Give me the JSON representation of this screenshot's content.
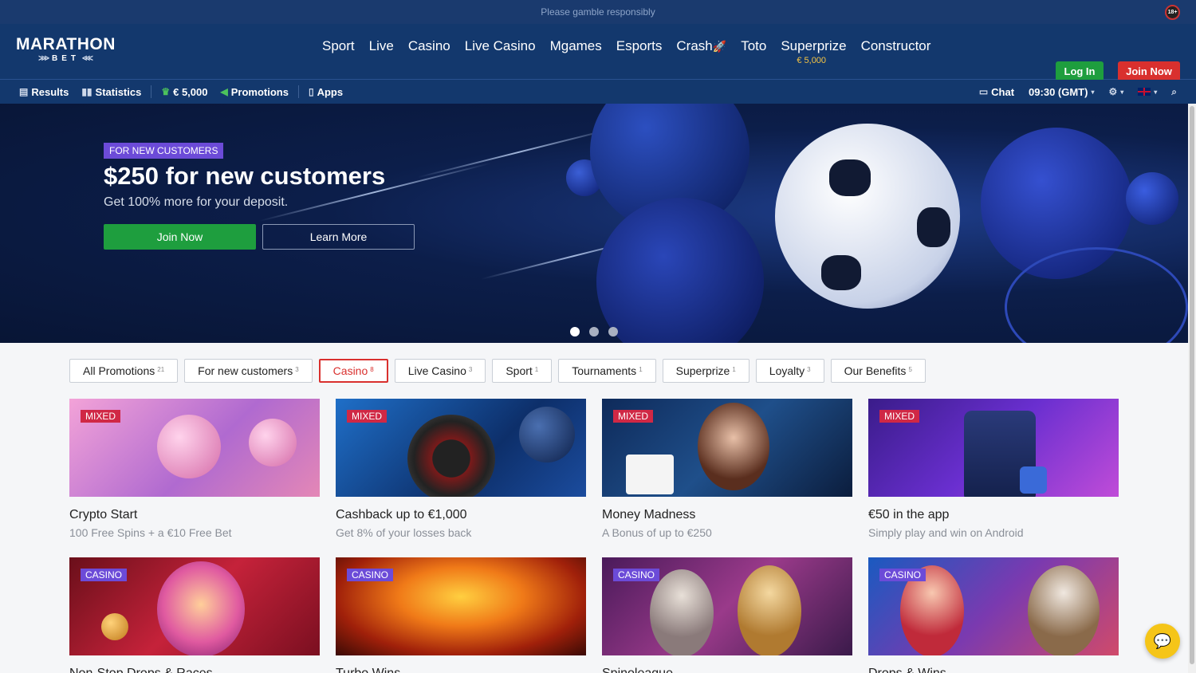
{
  "topbar": {
    "notice": "Please gamble responsibly",
    "age_badge": "18+"
  },
  "header": {
    "logo": {
      "main": "MARATHON",
      "sub": "BET"
    },
    "nav": [
      {
        "label": "Sport"
      },
      {
        "label": "Live"
      },
      {
        "label": "Casino"
      },
      {
        "label": "Live Casino"
      },
      {
        "label": "Mgames"
      },
      {
        "label": "Esports"
      },
      {
        "label": "Crash"
      },
      {
        "label": "Toto"
      },
      {
        "label": "Superprize",
        "sub": "€ 5,000"
      },
      {
        "label": "Constructor"
      }
    ],
    "login_label": "Log In",
    "join_label": "Join Now"
  },
  "subnav": {
    "results": "Results",
    "statistics": "Statistics",
    "jackpot": "€ 5,000",
    "promotions": "Promotions",
    "apps": "Apps",
    "chat": "Chat",
    "time": "09:30 (GMT)"
  },
  "hero": {
    "tag": "FOR NEW CUSTOMERS",
    "title": "$250 for new customers",
    "subtitle": "Get 100% more for your deposit.",
    "join_label": "Join Now",
    "learn_label": "Learn More",
    "slides": 3,
    "active_slide": 1
  },
  "filters": [
    {
      "label": "All Promotions",
      "count": "21"
    },
    {
      "label": "For new customers",
      "count": "3"
    },
    {
      "label": "Casino",
      "count": "8",
      "active": true
    },
    {
      "label": "Live Casino",
      "count": "3"
    },
    {
      "label": "Sport",
      "count": "1"
    },
    {
      "label": "Tournaments",
      "count": "1"
    },
    {
      "label": "Superprize",
      "count": "1"
    },
    {
      "label": "Loyalty",
      "count": "3"
    },
    {
      "label": "Our Benefits",
      "count": "5"
    }
  ],
  "cards": [
    {
      "tag": "MIXED",
      "title": "Crypto Start",
      "subtitle": "100 Free Spins + a €10 Free Bet"
    },
    {
      "tag": "MIXED",
      "title": "Cashback up to €1,000",
      "subtitle": "Get 8% of your losses back"
    },
    {
      "tag": "MIXED",
      "title": "Money Madness",
      "subtitle": "A Bonus of up to €250"
    },
    {
      "tag": "MIXED",
      "title": "€50 in the app",
      "subtitle": "Simply play and win on Android"
    },
    {
      "tag": "CASINO",
      "title": "Non-Stop Drops & Races",
      "subtitle": ""
    },
    {
      "tag": "CASINO",
      "title": "Turbo Wins",
      "subtitle": ""
    },
    {
      "tag": "CASINO",
      "title": "Spinoleague",
      "subtitle": ""
    },
    {
      "tag": "CASINO",
      "title": "Drops & Wins",
      "subtitle": ""
    }
  ],
  "colors": {
    "brand_blue": "#13386d",
    "green": "#1e9e3e",
    "red": "#d9302e",
    "purple_tag": "#6c4bd8",
    "mixed_tag": "#d02845"
  }
}
